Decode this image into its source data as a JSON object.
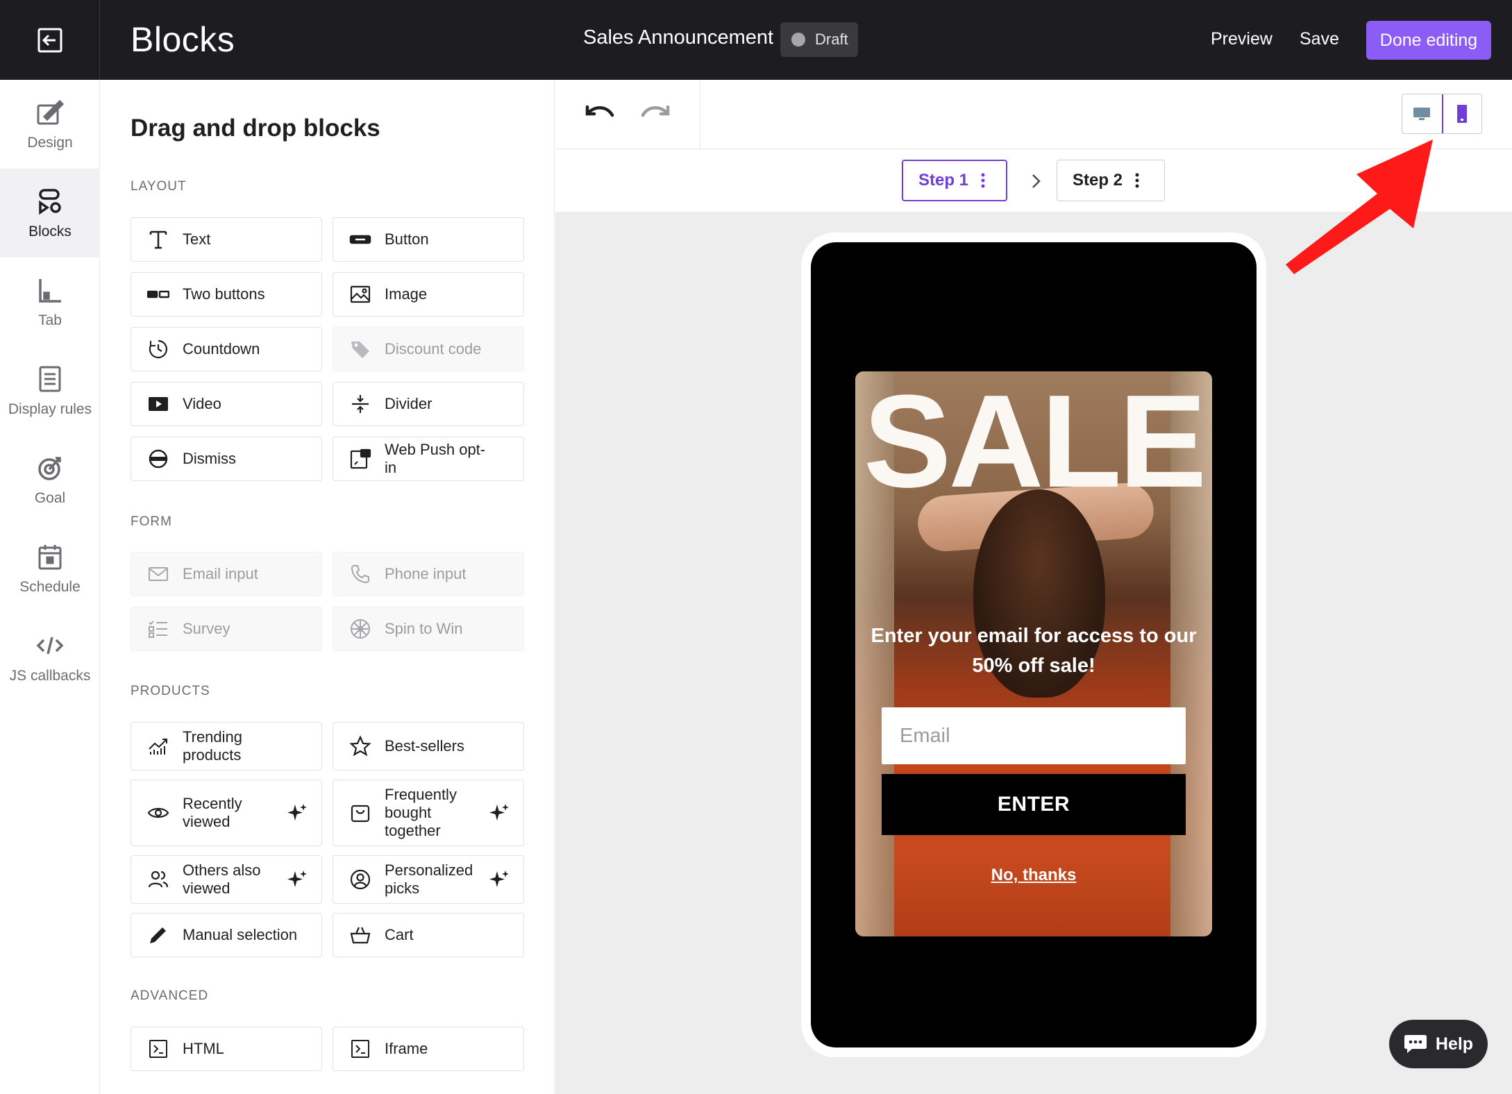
{
  "topbar": {
    "app_title": "Blocks",
    "campaign_name": "Sales Announcement",
    "status": "Draft",
    "preview_label": "Preview",
    "save_label": "Save",
    "done_label": "Done editing"
  },
  "leftnav": {
    "items": [
      {
        "label": "Design",
        "icon": "design-brush-icon"
      },
      {
        "label": "Blocks",
        "icon": "blocks-icon"
      },
      {
        "label": "Tab",
        "icon": "tab-icon"
      },
      {
        "label": "Display rules",
        "icon": "display-rules-icon"
      },
      {
        "label": "Goal",
        "icon": "goal-icon"
      },
      {
        "label": "Schedule",
        "icon": "schedule-icon"
      },
      {
        "label": "JS callbacks",
        "icon": "code-icon"
      }
    ]
  },
  "panel": {
    "title": "Drag and drop blocks",
    "sections": {
      "layout": "LAYOUT",
      "form": "FORM",
      "products": "PRODUCTS",
      "advanced": "ADVANCED"
    },
    "layout_blocks": [
      "Text",
      "Button",
      "Two buttons",
      "Image",
      "Countdown",
      "Discount code",
      "Video",
      "Divider",
      "Dismiss",
      "Web Push opt-in"
    ],
    "form_blocks": [
      "Email input",
      "Phone input",
      "Survey",
      "Spin to Win"
    ],
    "product_blocks": [
      "Trending products",
      "Best-sellers",
      "Recently viewed",
      "Frequently bought together",
      "Others also viewed",
      "Personalized picks",
      "Manual selection",
      "Cart"
    ],
    "advanced_blocks": [
      "HTML",
      "Iframe"
    ]
  },
  "editor": {
    "steps": [
      "Step 1",
      "Step 2"
    ],
    "active_step": "Step 1"
  },
  "popup": {
    "hero_text": "SALE",
    "headline": "Enter your email for access to our 50% off sale!",
    "email_placeholder": "Email",
    "cta_label": "ENTER",
    "dismiss_label": "No, thanks"
  },
  "help_label": "Help",
  "colors": {
    "accent": "#8b5cf6",
    "active_outline": "#6d3fd6",
    "topbar": "#1d1c20",
    "annotation_arrow": "#ff1a1a"
  }
}
